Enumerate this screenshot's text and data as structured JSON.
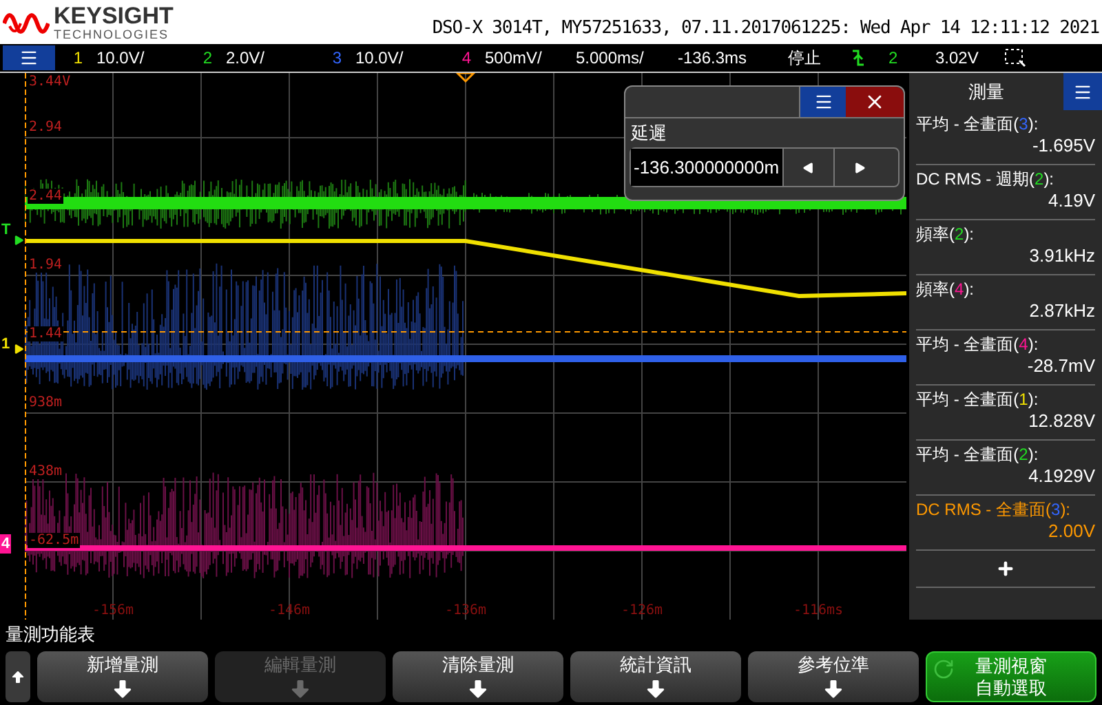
{
  "header": {
    "brand": "KEYSIGHT",
    "brand_sub": "TECHNOLOGIES",
    "title": "DSO-X 3014T, MY57251633, 07.11.2017061225: Wed Apr 14 12:11:12 2021"
  },
  "channel_bar": {
    "channels": [
      {
        "number": "1",
        "scale": "10.0V/",
        "color": "#f0e000"
      },
      {
        "number": "2",
        "scale": "2.0V/",
        "color": "#22dd22"
      },
      {
        "number": "3",
        "scale": "10.0V/",
        "color": "#3366ff"
      },
      {
        "number": "4",
        "scale": "500mV/",
        "color": "#ff1493"
      }
    ],
    "timebase": "5.000ms/",
    "delay": "-136.3ms",
    "run_state": "停止",
    "trigger": {
      "channel": "2",
      "color": "#22dd22",
      "level": "3.02V"
    }
  },
  "plot": {
    "y_labels": [
      "3.44V",
      "2.94",
      "2.44",
      "1.94",
      "1.44",
      "938m",
      "438m",
      "-62.5m"
    ],
    "x_labels": [
      "-156m",
      "-146m",
      "-136m",
      "-126m",
      "-116ms"
    ],
    "markers": [
      {
        "label": "T",
        "color": "#22dd22"
      },
      {
        "label": "1",
        "color": "#f0e000"
      },
      {
        "label": "4",
        "color": "#ff1493"
      }
    ]
  },
  "delay_dialog": {
    "label": "延遲",
    "value": "-136.300000000m"
  },
  "measurements": {
    "title": "測量",
    "items": [
      {
        "function": "平均 - 全畫面(",
        "channel": "3",
        "color": "#3366ff",
        "suffix": "):",
        "result": "-1.695V",
        "selected": false
      },
      {
        "function": "DC RMS - 週期(",
        "channel": "2",
        "color": "#22dd22",
        "suffix": "):",
        "result": "4.19V",
        "selected": false
      },
      {
        "function": "頻率(",
        "channel": "2",
        "color": "#22dd22",
        "suffix": "):",
        "result": "3.91kHz",
        "selected": false
      },
      {
        "function": "頻率(",
        "channel": "4",
        "color": "#ff1493",
        "suffix": "):",
        "result": "2.87kHz",
        "selected": false
      },
      {
        "function": "平均 - 全畫面(",
        "channel": "4",
        "color": "#ff1493",
        "suffix": "):",
        "result": "-28.7mV",
        "selected": false
      },
      {
        "function": "平均 - 全畫面(",
        "channel": "1",
        "color": "#f0e000",
        "suffix": "):",
        "result": "12.828V",
        "selected": false
      },
      {
        "function": "平均 - 全畫面(",
        "channel": "2",
        "color": "#22dd22",
        "suffix": "):",
        "result": "4.1929V",
        "selected": false
      },
      {
        "function": "DC RMS - 全畫面(",
        "channel": "3",
        "color": "#3366ff",
        "suffix": "):",
        "result": "2.00V",
        "selected": true
      }
    ]
  },
  "softkeys": {
    "title": "量測功能表",
    "buttons": [
      {
        "kind": "menu",
        "label": "新增量測",
        "disabled": false
      },
      {
        "kind": "menu",
        "label": "編輯量測",
        "disabled": true
      },
      {
        "kind": "menu",
        "label": "清除量測",
        "disabled": false
      },
      {
        "kind": "menu",
        "label": "統計資訊",
        "disabled": false
      },
      {
        "kind": "menu",
        "label": "參考位準",
        "disabled": false
      },
      {
        "kind": "toggle",
        "label": "量測視窗",
        "label_2": "自動選取",
        "disabled": false
      }
    ]
  }
}
